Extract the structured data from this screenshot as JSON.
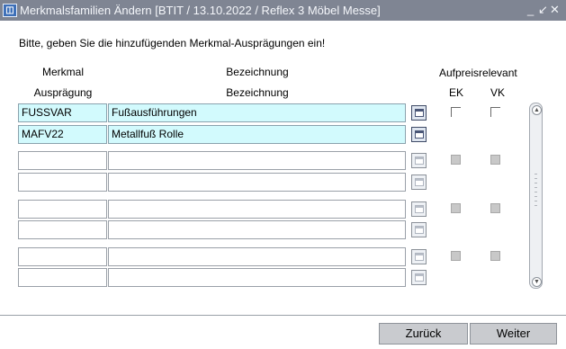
{
  "window": {
    "title": "Merkmalsfamilien Ändern   [BTIT / 13.10.2022 / Reflex 3 Möbel Messe]",
    "controls": [
      "_",
      "↙",
      "✕"
    ]
  },
  "instruction": "Bitte, geben Sie die hinzufügenden Merkmal-Ausprägungen ein!",
  "headers": {
    "merkmal": "Merkmal",
    "auspraegung": "Ausprägung",
    "bezeichnung1": "Bezeichnung",
    "bezeichnung2": "Bezeichnung",
    "aufpreis": "Aufpreisrelevant",
    "ek": "EK",
    "vk": "VK"
  },
  "rows": [
    {
      "code": "FUSSVAR",
      "bez": "Fußausführungen",
      "lov_enabled": true
    },
    {
      "code": "MAFV22",
      "bez": "Metallfuß Rolle",
      "lov_enabled": true
    },
    {
      "code": "",
      "bez": "",
      "lov_enabled": false
    },
    {
      "code": "",
      "bez": "",
      "lov_enabled": false
    },
    {
      "code": "",
      "bez": "",
      "lov_enabled": false
    },
    {
      "code": "",
      "bez": "",
      "lov_enabled": false
    },
    {
      "code": "",
      "bez": "",
      "lov_enabled": false
    },
    {
      "code": "",
      "bez": "",
      "lov_enabled": false
    }
  ],
  "checkbox_pairs": [
    {
      "ek": false,
      "vk": false,
      "enabled": true
    },
    {
      "ek": false,
      "vk": false,
      "enabled": false
    },
    {
      "ek": false,
      "vk": false,
      "enabled": false
    },
    {
      "ek": false,
      "vk": false,
      "enabled": false
    }
  ],
  "buttons": {
    "back": "Zurück",
    "next": "Weiter"
  },
  "icons": {
    "window": "form-window-icon",
    "lov": "list-of-values-icon"
  },
  "colors": {
    "titlebar": "#7f8593",
    "filled_field": "#d2fafd"
  }
}
